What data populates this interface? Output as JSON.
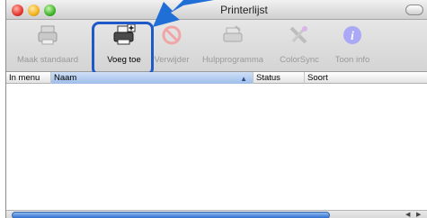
{
  "window": {
    "title": "Printerlijst"
  },
  "toolbar": {
    "items": [
      {
        "label": "Maak standaard",
        "icon": "printer-default-icon",
        "enabled": false
      },
      {
        "label": "Voeg toe",
        "icon": "add-printer-icon",
        "enabled": true
      },
      {
        "label": "Verwijder",
        "icon": "delete-icon",
        "enabled": false
      },
      {
        "label": "Hulpprogramma",
        "icon": "utility-icon",
        "enabled": false
      },
      {
        "label": "ColorSync",
        "icon": "colorsync-icon",
        "enabled": false
      },
      {
        "label": "Toon info",
        "icon": "info-icon",
        "enabled": false
      }
    ]
  },
  "table": {
    "columns": [
      "In menu",
      "Naam",
      "Status",
      "Soort"
    ],
    "sorted_column": "Naam"
  },
  "colors": {
    "highlight": "#1f59c8",
    "arrow": "#1f6fd6",
    "sort_header": "#9ebde9"
  }
}
